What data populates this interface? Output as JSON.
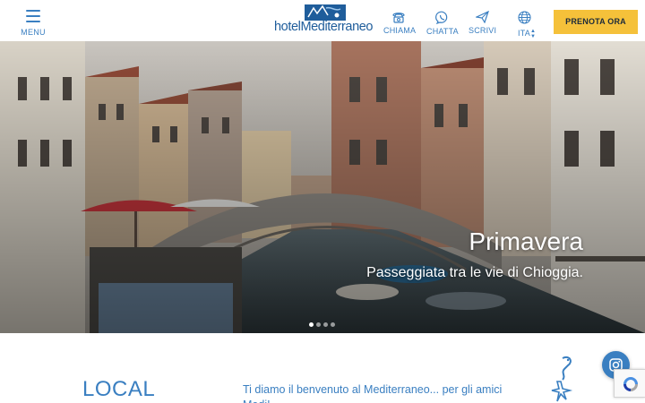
{
  "header": {
    "menu_label": "MENU",
    "logo_text_prefix": "hotel",
    "logo_text_main": "Mediterraneo",
    "actions": [
      {
        "label": "CHIAMA",
        "icon": "phone-icon"
      },
      {
        "label": "CHATTA",
        "icon": "whatsapp-icon"
      },
      {
        "label": "SCRIVI",
        "icon": "paper-plane-icon"
      }
    ],
    "language": {
      "label": "ITA",
      "icon": "globe-icon"
    },
    "book_label": "PRENOTA ORA"
  },
  "hero": {
    "title": "Primavera",
    "subtitle": "Passeggiata tra le vie di Chioggia.",
    "slides_count": 4,
    "active_slide": 1
  },
  "intro": {
    "heading": "LOCAL",
    "welcome_text": "Ti diamo il benvenuto al Mediterraneo... per gli amici Medi!"
  },
  "floating": {
    "instagram_icon": "instagram-icon",
    "captcha_icon": "recaptcha-icon"
  },
  "colors": {
    "brand_blue": "#3a7fc1",
    "book_button": "#f5c13a"
  }
}
